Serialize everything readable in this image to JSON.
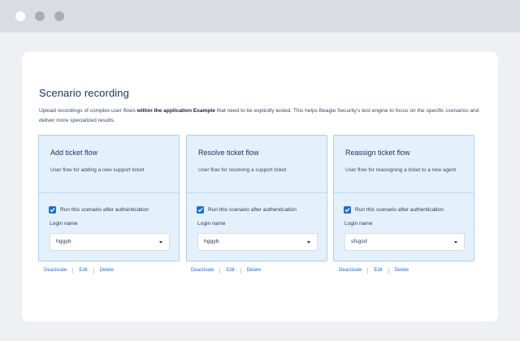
{
  "window": {
    "controls": [
      "close-dot",
      "minimize-dot",
      "maximize-dot"
    ]
  },
  "page": {
    "title": "Scenario recording",
    "description_pre": "Upload recordings of complex user flows ",
    "description_bold": "within the application Example",
    "description_post": " that need to be explicitly tested. This helps Beagle Security's test engine to focus on the specific scenarios and deliver more specialized results."
  },
  "cards": [
    {
      "title": "Add ticket flow",
      "description": "User flow for adding a new support ticket",
      "checkbox_label": "Run this scenario after authentication",
      "checked": true,
      "login_label": "Login name",
      "login_value": "hggyb",
      "actions": [
        "Deactivate",
        "Edit",
        "Delete"
      ]
    },
    {
      "title": "Resolve ticket flow",
      "description": "User flow for resolving a support ticket",
      "checkbox_label": "Run this scenario after authentication",
      "checked": true,
      "login_label": "Login name",
      "login_value": "hggyb",
      "actions": [
        "Deactivate",
        "Edit",
        "Delete"
      ]
    },
    {
      "title": "Reassign ticket flow",
      "description": "User flow for reassigning a ticket to a new agent",
      "checkbox_label": "Run this scenario after authentication",
      "checked": true,
      "login_label": "Login name",
      "login_value": "sfsgsd",
      "actions": [
        "Deactivate",
        "Edit",
        "Delete"
      ]
    }
  ],
  "colors": {
    "accent": "#1f6fd1",
    "card_bg": "#e4f1fc",
    "card_border": "#a8d0f2",
    "heading": "#17325c"
  },
  "icons": {
    "checkbox": "checkmark-icon",
    "select": "chevron-down-icon"
  }
}
